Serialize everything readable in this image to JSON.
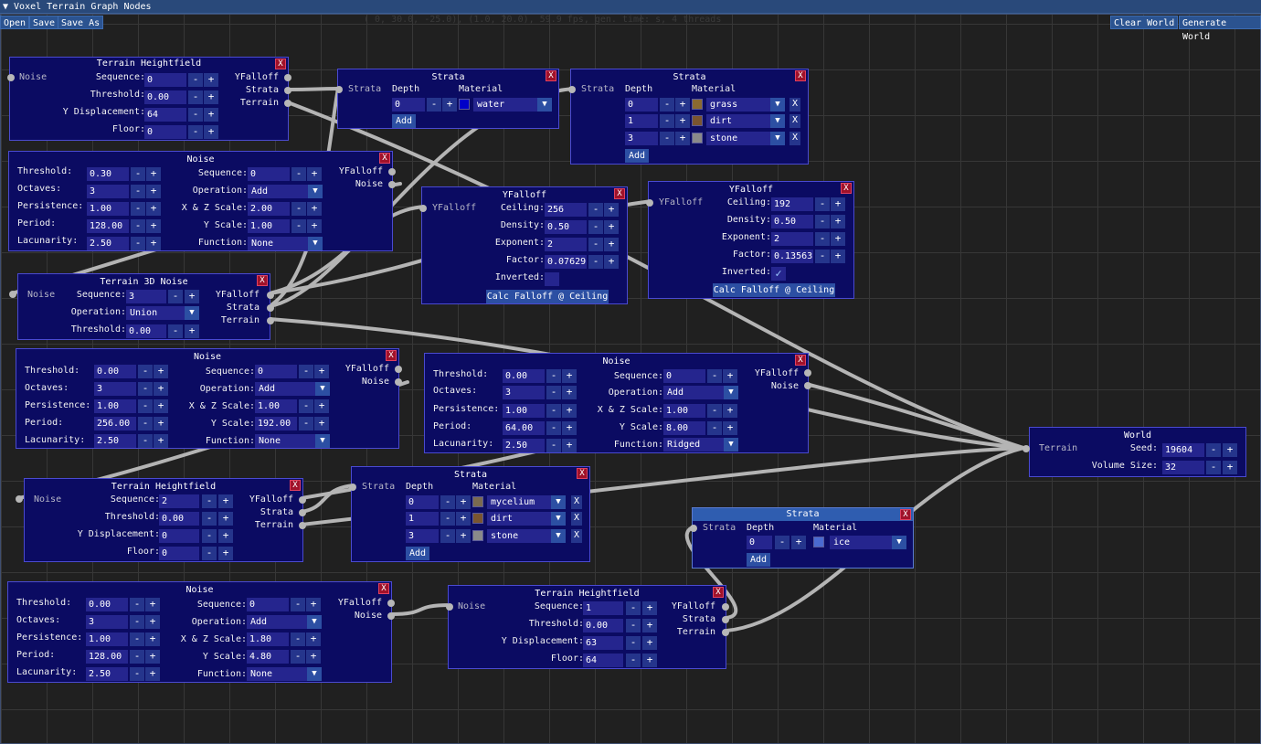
{
  "window": {
    "title": "▼ Voxel Terrain Graph Nodes"
  },
  "toolbar": {
    "open": "Open",
    "save": "Save",
    "save_as": "Save As",
    "clear_world": "Clear World",
    "generate_world": "Generate World"
  },
  "status": "( 0, 30.0, -25.0), (1.0, 20.0), 59.9 fps,     gen. time:     s, 4 threads",
  "common": {
    "close": "X",
    "minus": "-",
    "plus": "+",
    "dropdown": "▼",
    "add": "Add",
    "check": "✓",
    "delete": "X"
  },
  "labels": {
    "noise": "Noise",
    "yfalloff": "YFalloff",
    "strata": "Strata",
    "terrain": "Terrain",
    "sequence": "Sequence:",
    "threshold": "Threshold:",
    "ydisp": "Y Displacement:",
    "floor": "Floor:",
    "octaves": "Octaves:",
    "persistence": "Persistence:",
    "period": "Period:",
    "lacunarity": "Lacunarity:",
    "operation": "Operation:",
    "xzscale": "X & Z Scale:",
    "yscale": "Y   Scale:",
    "function": "Function:",
    "depth": "Depth",
    "material": "Material",
    "ceiling": "Ceiling:",
    "density": "Density:",
    "exponent": "Exponent:",
    "factor": "Factor:",
    "inverted": "Inverted:",
    "seed": "Seed:",
    "volume_size": "Volume Size:",
    "calc": "Calc Falloff @ Ceiling"
  },
  "nodes": {
    "th1": {
      "title": "Terrain Heightfield",
      "sequence": "0",
      "threshold": "0.00",
      "ydisp": "64",
      "floor": "0"
    },
    "strata1": {
      "title": "Strata",
      "rows": [
        {
          "depth": "0",
          "material": "water"
        }
      ]
    },
    "strata2": {
      "title": "Strata",
      "rows": [
        {
          "depth": "0",
          "material": "grass"
        },
        {
          "depth": "1",
          "material": "dirt"
        },
        {
          "depth": "3",
          "material": "stone"
        }
      ]
    },
    "noise1": {
      "title": "Noise",
      "threshold": "0.30",
      "octaves": "3",
      "persistence": "1.00",
      "period": "128.00",
      "lacunarity": "2.50",
      "sequence": "0",
      "operation": "Add",
      "xzscale": "2.00",
      "yscale": "1.00",
      "function": "None"
    },
    "yf1": {
      "title": "YFalloff",
      "ceiling": "256",
      "density": "0.50",
      "exponent": "2",
      "factor": "0.07629",
      "inverted": false
    },
    "yf2": {
      "title": "YFalloff",
      "ceiling": "192",
      "density": "0.50",
      "exponent": "2",
      "factor": "0.13563",
      "inverted": true
    },
    "t3d": {
      "title": "Terrain 3D Noise",
      "sequence": "3",
      "operation": "Union",
      "threshold": "0.00"
    },
    "noise2": {
      "title": "Noise",
      "threshold": "0.00",
      "octaves": "3",
      "persistence": "1.00",
      "period": "256.00",
      "lacunarity": "2.50",
      "sequence": "0",
      "operation": "Add",
      "xzscale": "1.00",
      "yscale": "192.00",
      "function": "None"
    },
    "noise3": {
      "title": "Noise",
      "threshold": "0.00",
      "octaves": "3",
      "persistence": "1.00",
      "period": "64.00",
      "lacunarity": "2.50",
      "sequence": "0",
      "operation": "Add",
      "xzscale": "1.00",
      "yscale": "8.00",
      "function": "Ridged"
    },
    "world": {
      "title": "World",
      "seed": "19604",
      "volume_size": "32"
    },
    "th2": {
      "title": "Terrain Heightfield",
      "sequence": "2",
      "threshold": "0.00",
      "ydisp": "0",
      "floor": "0"
    },
    "strata3": {
      "title": "Strata",
      "rows": [
        {
          "depth": "0",
          "material": "mycelium"
        },
        {
          "depth": "1",
          "material": "dirt"
        },
        {
          "depth": "3",
          "material": "stone"
        }
      ]
    },
    "strata4": {
      "title": "Strata",
      "rows": [
        {
          "depth": "0",
          "material": "ice"
        }
      ]
    },
    "noise4": {
      "title": "Noise",
      "threshold": "0.00",
      "octaves": "3",
      "persistence": "1.00",
      "period": "128.00",
      "lacunarity": "2.50",
      "sequence": "0",
      "operation": "Add",
      "xzscale": "1.80",
      "yscale": "4.80",
      "function": "None"
    },
    "th3": {
      "title": "Terrain Heightfield",
      "sequence": "1",
      "threshold": "0.00",
      "ydisp": "63",
      "floor": "64"
    }
  },
  "colors": {
    "water": "#0000c8",
    "grass": "#8a6a30",
    "dirt": "#7a5530",
    "stone": "#8a8a8a",
    "mycelium": "#7a6a50",
    "ice": "#4a6ad0",
    "link": "#b4b4b4"
  }
}
